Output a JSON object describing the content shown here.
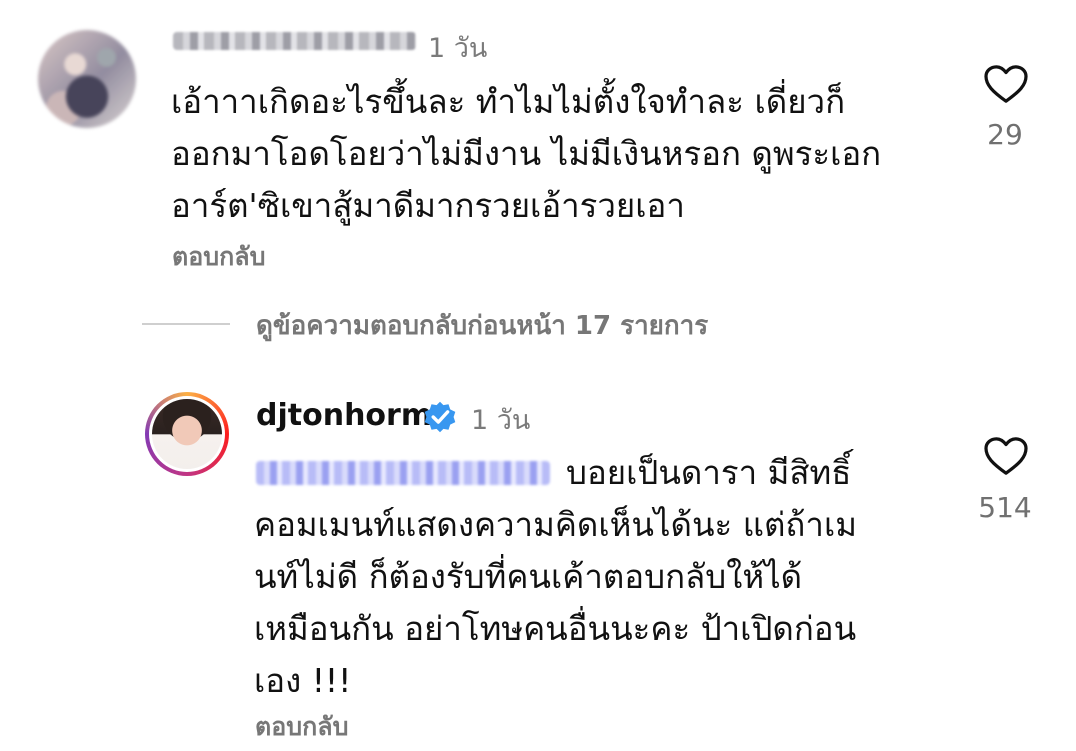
{
  "comment1": {
    "time": "1 วัน",
    "lines": [
      "เอ้าาาเกิดอะไรขึ้นละ ทำไมไม่ตั้งใจทำละ เดี่ยวก็",
      "ออกมาโอดโอยว่าไม่มีงาน ไม่มีเงินหรอก ดูพระเอก",
      "อาร์ต'ซิเขาสู้มาดีมากรวยเอ้ารวยเอา"
    ],
    "reply_label": "ตอบกลับ",
    "likes": "29"
  },
  "view_replies": {
    "label": "ดูข้อความตอบกลับก่อนหน้า 17 รายการ"
  },
  "comment2": {
    "username": "djtonhorm",
    "time": "1 วัน",
    "first_line_rest": "บอยเป็นดารา มีสิทธิ์",
    "lines": [
      "คอมเมนท์แสดงความคิดเห็นได้นะ แต่ถ้าเม",
      "นท์ไม่ดี ก็ต้องรับที่คนเค้าตอบกลับให้ได้",
      "เหมือนกัน อย่าโทษคนอื่นนะคะ ป้าเปิดก่อน",
      "เอง !!!"
    ],
    "reply_label": "ตอบกลับ",
    "likes": "514"
  },
  "colors": {
    "text": "#111111",
    "muted": "#777777",
    "verified": "#3897f0"
  },
  "icons": {
    "heart": "heart-outline-icon",
    "verified": "verified-badge-icon"
  }
}
